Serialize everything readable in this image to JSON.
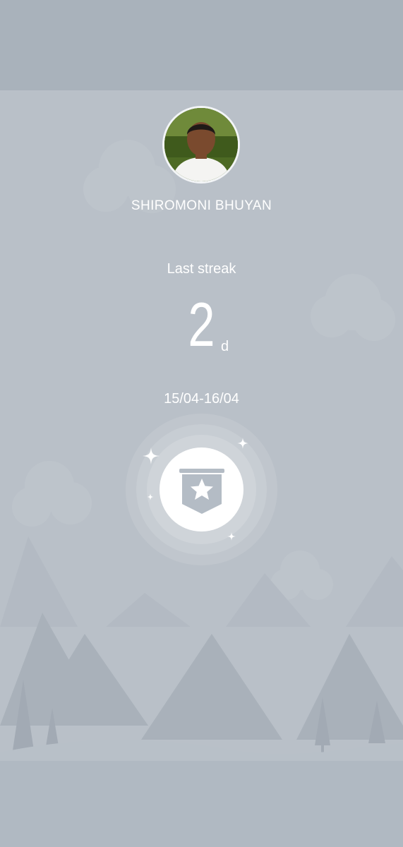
{
  "profile": {
    "name": "SHIROMONI BHUYAN",
    "avatar_icon": "avatar-photo"
  },
  "streak": {
    "label": "Last streak",
    "value": "2",
    "unit": "d",
    "date_range": "15/04-16/04"
  },
  "badge": {
    "icon": "banner-star-icon",
    "decor": "sparkle-icon"
  },
  "colors": {
    "background": "#b9c0c8",
    "top_bar": "#a9b2bb",
    "text": "#ffffff",
    "badge_fill": "#b4bcc5"
  }
}
